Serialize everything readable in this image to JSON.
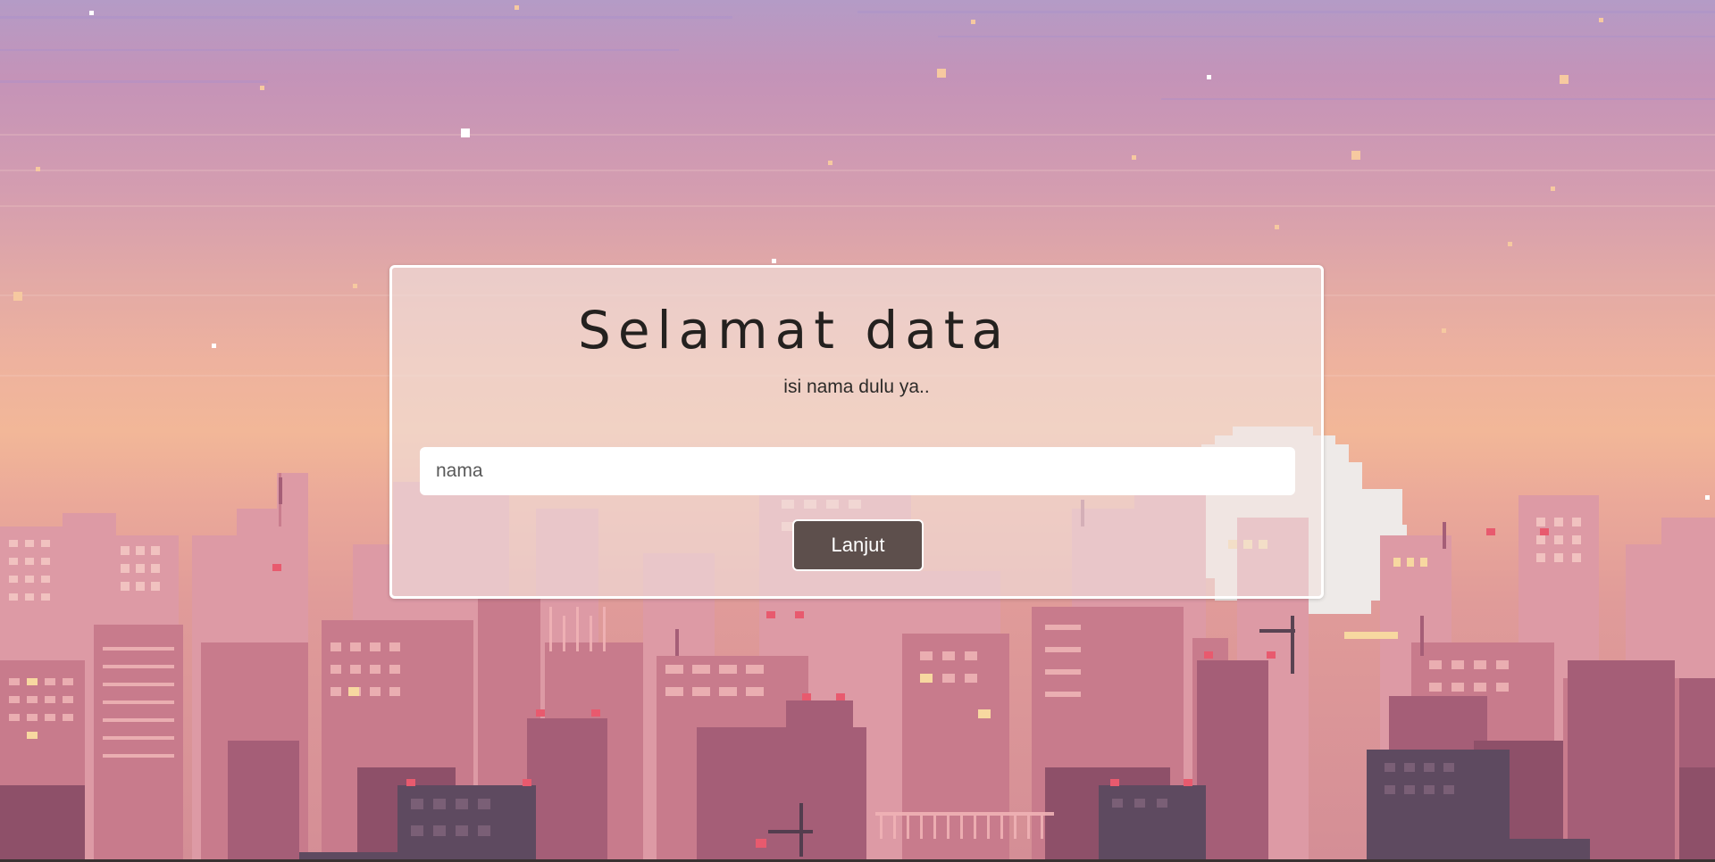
{
  "card": {
    "title": "Selamat data",
    "subtitle": "isi nama dulu ya..",
    "input_placeholder": "nama",
    "input_value": "",
    "button_label": "Lanjut"
  },
  "colors": {
    "sky_top": "#b49bc6",
    "sky_mid": "#eeb29e",
    "building_light": "#d88d9c",
    "building_mid": "#c27286",
    "building_dark": "#5e4a60",
    "window": "#f2c9c4",
    "window_lit": "#f7d8a0",
    "moon": "#eeeae8",
    "button_bg": "#5d4f4c"
  }
}
